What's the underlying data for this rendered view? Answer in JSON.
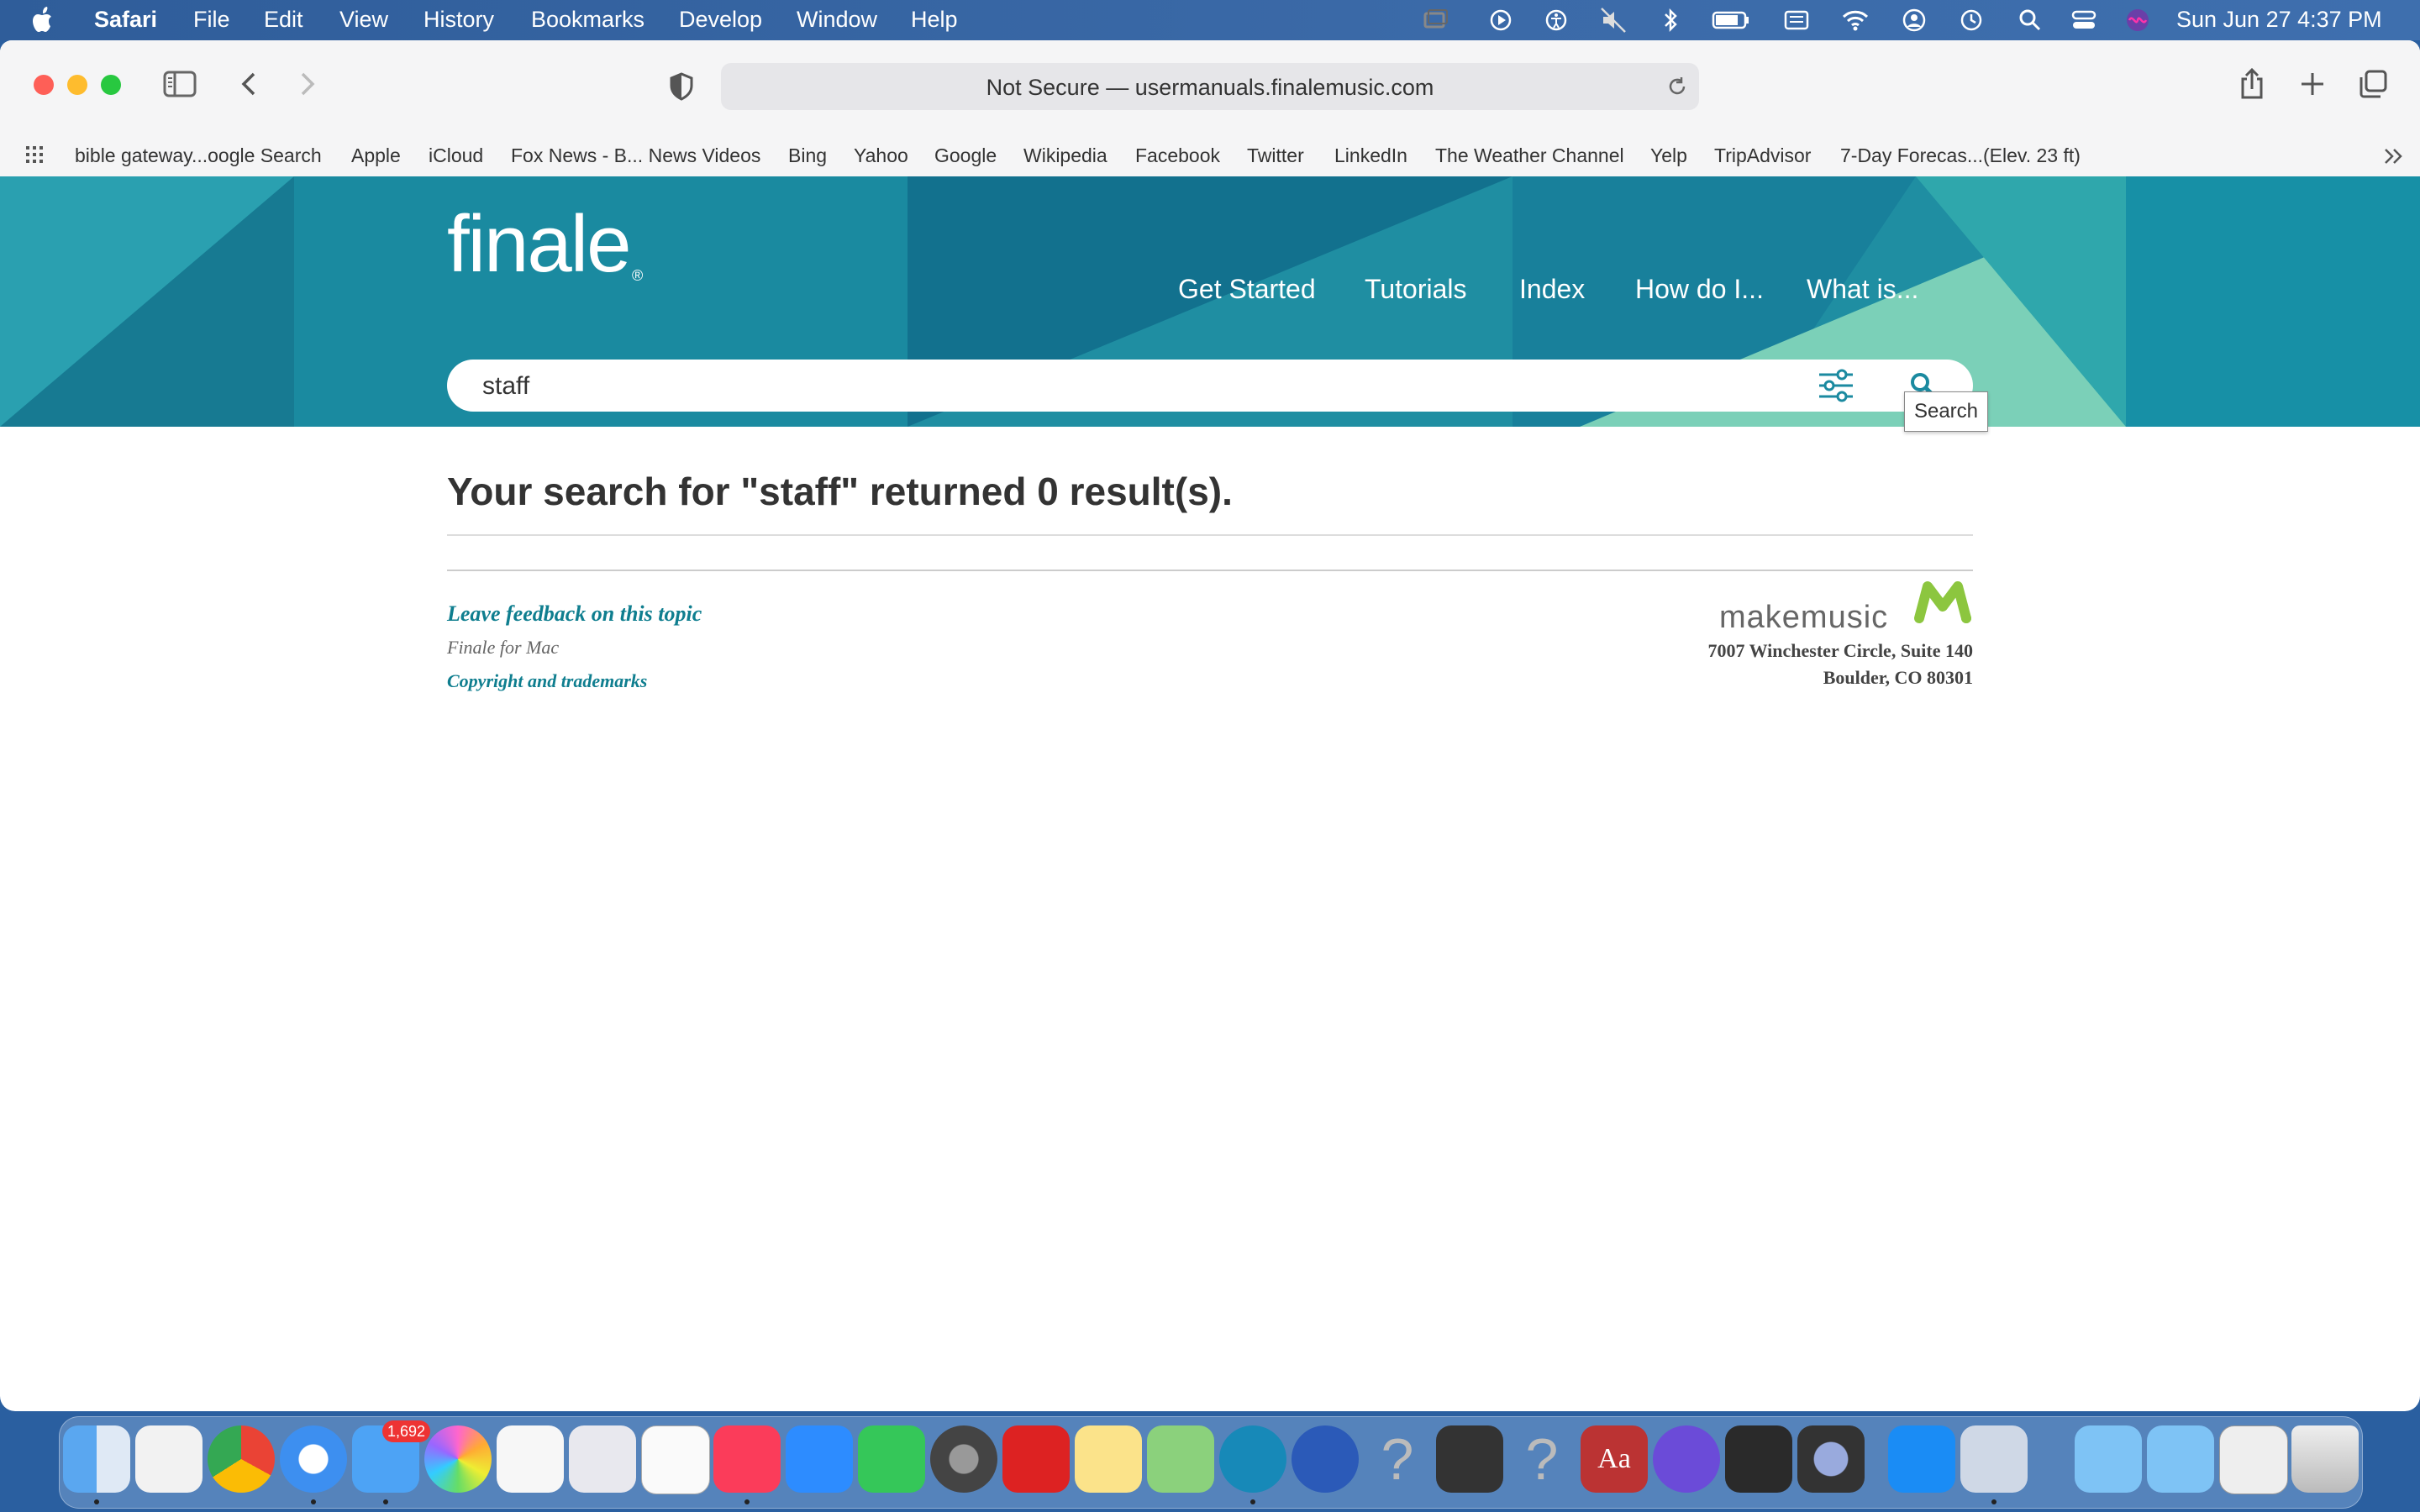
{
  "menubar": {
    "app": "Safari",
    "items": [
      "File",
      "Edit",
      "View",
      "History",
      "Bookmarks",
      "Develop",
      "Window",
      "Help"
    ],
    "datetime": "Sun Jun 27  4:37 PM",
    "status_icons": [
      "screen-mirror-icon",
      "play-icon",
      "accessibility-icon",
      "mute-icon",
      "bluetooth-icon",
      "battery-icon",
      "keyboard-icon",
      "wifi-icon",
      "user-icon",
      "time-machine-icon",
      "spotlight-icon",
      "control-center-icon",
      "siri-icon"
    ]
  },
  "browser": {
    "url": "Not Secure — usermanuals.finalemusic.com",
    "bookmarks": [
      "bible gateway...oogle Search",
      "Apple",
      "iCloud",
      "Fox News - B... News Videos",
      "Bing",
      "Yahoo",
      "Google",
      "Wikipedia",
      "Facebook",
      "Twitter",
      "LinkedIn",
      "The Weather Channel",
      "Yelp",
      "TripAdvisor",
      "7-Day Forecas...(Elev. 23 ft)"
    ]
  },
  "site": {
    "logo": "finale",
    "nav": [
      "Get Started",
      "Tutorials",
      "Index",
      "How do I...",
      "What is..."
    ],
    "search_value": "staff",
    "tooltip": "Search",
    "result_heading": "Your search for \"staff\" returned 0 result(s).",
    "feedback": "Leave feedback on this topic",
    "product": "Finale for Mac",
    "copyright": "Copyright and trademarks",
    "brand": "makemusic",
    "address_line1": "7007 Winchester Circle, Suite 140",
    "address_line2": "Boulder, CO 80301"
  },
  "dock": {
    "mail_badge": "1,692",
    "apps": [
      "finder-icon",
      "textedit-icon",
      "chrome-icon",
      "safari-icon",
      "mail-icon",
      "photos-icon",
      "pages-icon",
      "launchpad-icon",
      "document-icon",
      "music-icon",
      "zoom-icon",
      "messages-icon",
      "system-preferences-icon",
      "photo-booth-icon",
      "notes-icon",
      "maps-icon",
      "finale-icon",
      "rocket-typist-icon",
      "help-icon",
      "printer-icon",
      "help-icon-2",
      "dictionary-icon",
      "imovie-icon",
      "garageband-icon",
      "quicktime-icon",
      "app-store-icon",
      "preview-icon",
      "applications-folder-icon",
      "documents-folder-icon",
      "downloads-icon",
      "trash-icon"
    ]
  }
}
